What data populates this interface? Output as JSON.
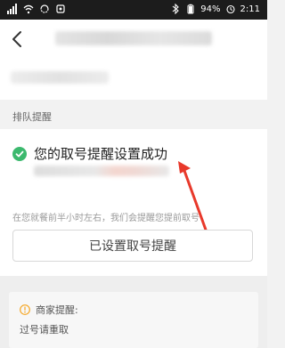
{
  "status_bar": {
    "battery": "94%",
    "time": "2:11"
  },
  "section": {
    "title": "排队提醒"
  },
  "reminder": {
    "success_message": "您的取号提醒设置成功",
    "hint": "在您就餐前半小时左右，我们会提醒您提前取号",
    "button_label": "已设置取号提醒"
  },
  "notice": {
    "title": "商家提醒:",
    "text": "过号请重取"
  },
  "colors": {
    "success_green": "#3cb96e",
    "arrow_red": "#e8392b",
    "notice_orange": "#f5a623"
  }
}
